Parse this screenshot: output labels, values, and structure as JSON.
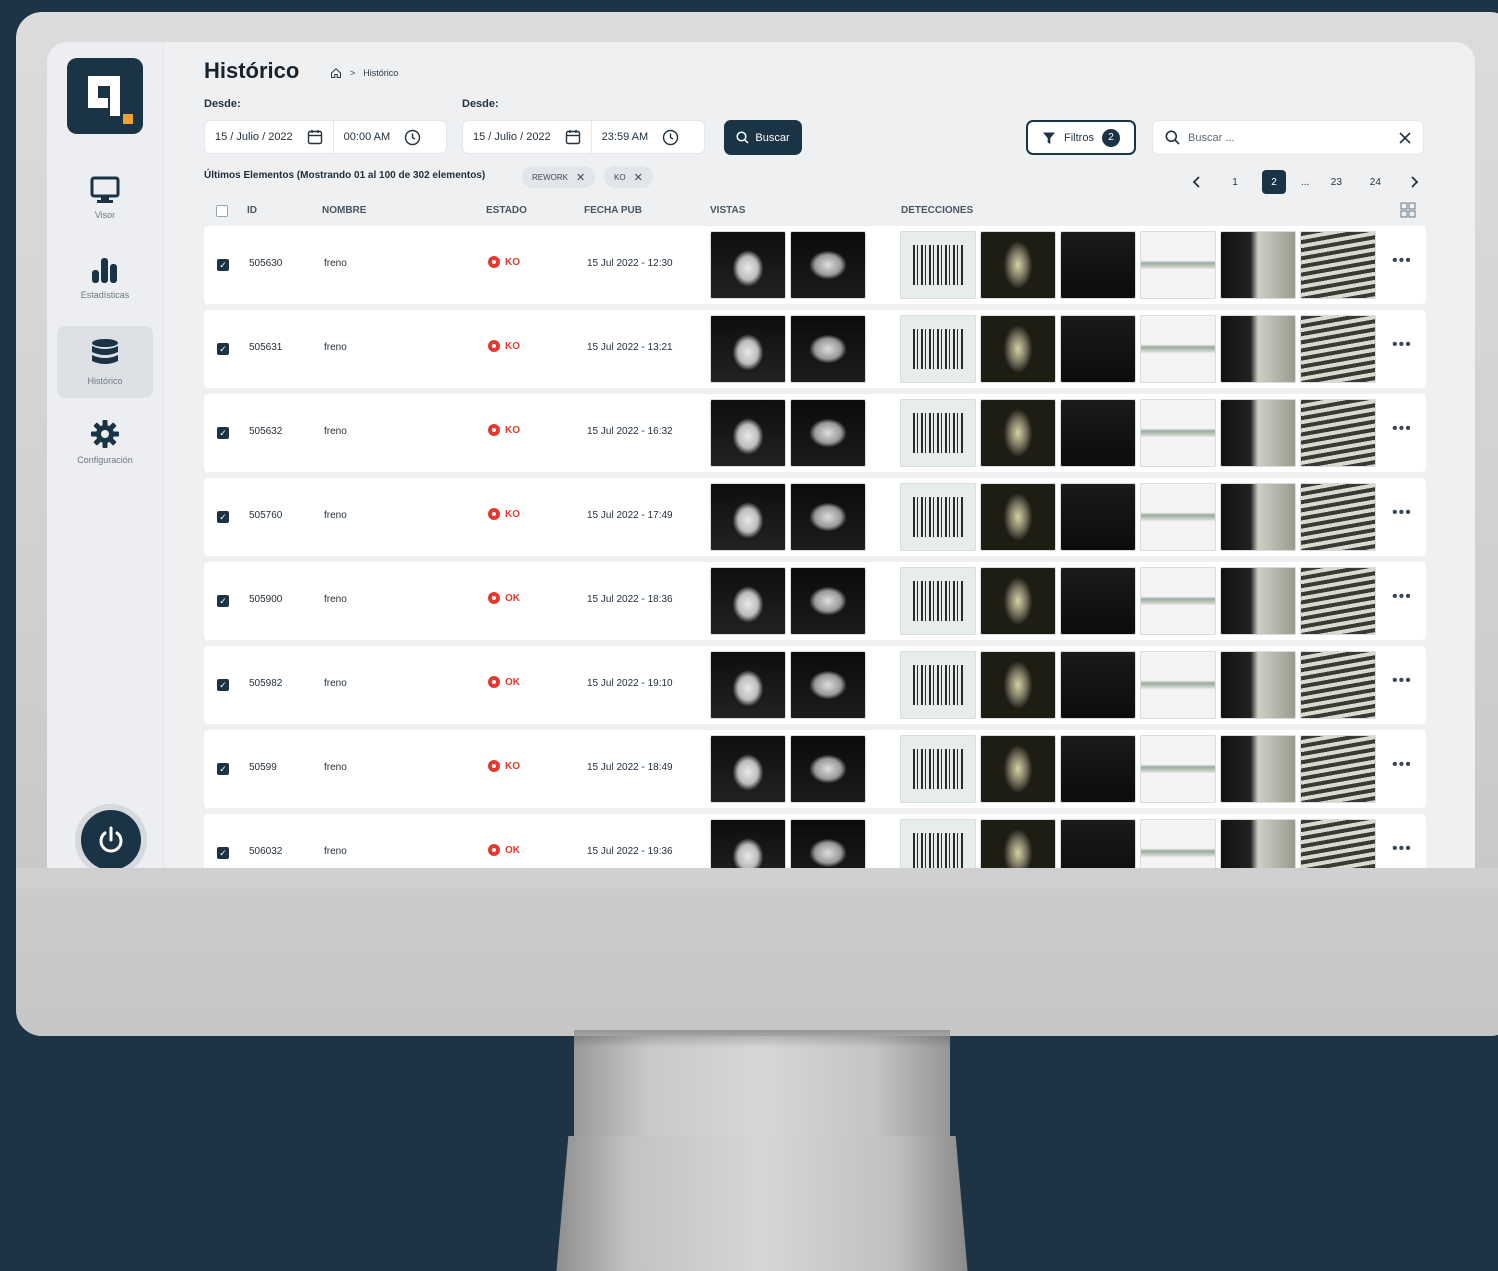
{
  "sidebar": {
    "items": [
      {
        "label": "Visor",
        "icon": "monitor-icon"
      },
      {
        "label": "Estadísticas",
        "icon": "bar-chart-icon"
      },
      {
        "label": "Histórico",
        "icon": "database-icon",
        "active": true
      },
      {
        "label": "Configuración",
        "icon": "gear-icon"
      }
    ]
  },
  "header": {
    "title": "Histórico",
    "breadcrumb": {
      "separator": ">",
      "current": "Histórico"
    }
  },
  "filters": {
    "from_label": "Desde:",
    "from_date": "15 / Julio / 2022",
    "from_time": "00:00 AM",
    "to_label": "Desde:",
    "to_date": "15 / Julio / 2022",
    "to_time": "23:59 AM",
    "buscar_label": "Buscar",
    "filtros_label": "Filtros",
    "filtros_count": "2",
    "search_placeholder": "Buscar ..."
  },
  "summary": {
    "text": "Últimos Elementos (Mostrando 01 al 100 de 302 elementos)",
    "chips": [
      "REWORK",
      "KO"
    ]
  },
  "pagination": {
    "pages": [
      "1",
      "2",
      "...",
      "23",
      "24"
    ],
    "current": "2"
  },
  "table": {
    "columns": [
      "ID",
      "NOMBRE",
      "ESTADO",
      "FECHA PUB",
      "VISTAS",
      "DETECCIONES"
    ],
    "rows": [
      {
        "id": "505630",
        "nombre": "freno",
        "estado": "KO",
        "fecha": "15 Jul 2022 - 12:30"
      },
      {
        "id": "505631",
        "nombre": "freno",
        "estado": "KO",
        "fecha": "15 Jul 2022 - 13:21"
      },
      {
        "id": "505632",
        "nombre": "freno",
        "estado": "KO",
        "fecha": "15 Jul 2022 - 16:32"
      },
      {
        "id": "505760",
        "nombre": "freno",
        "estado": "KO",
        "fecha": "15 Jul 2022 - 17:49"
      },
      {
        "id": "505900",
        "nombre": "freno",
        "estado": "OK",
        "fecha": "15 Jul 2022 - 18:36"
      },
      {
        "id": "505982",
        "nombre": "freno",
        "estado": "OK",
        "fecha": "15 Jul 2022 - 19:10"
      },
      {
        "id": "50599",
        "nombre": "freno",
        "estado": "KO",
        "fecha": "15 Jul 2022 - 18:49"
      },
      {
        "id": "506032",
        "nombre": "freno",
        "estado": "OK",
        "fecha": "15 Jul 2022 - 19:36"
      }
    ]
  },
  "colors": {
    "primary": "#1b3445",
    "status_red": "#e5392f",
    "accent": "#f0a030"
  }
}
